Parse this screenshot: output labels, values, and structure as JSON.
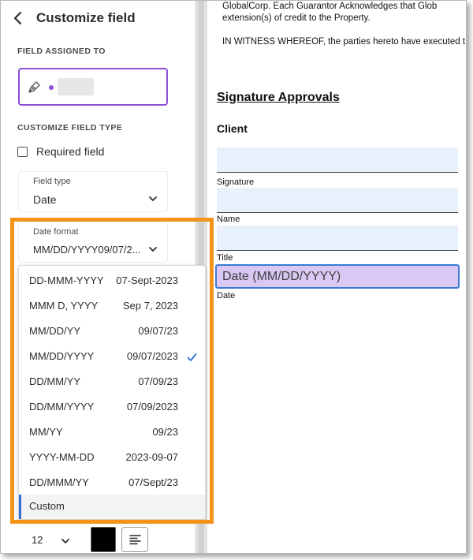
{
  "panel": {
    "title": "Customize field",
    "field_assigned_heading": "FIELD ASSIGNED TO",
    "customize_type_heading": "CUSTOMIZE FIELD TYPE",
    "required_label": "Required field",
    "required_checked": false,
    "field_type": {
      "caption": "Field type",
      "value": "Date"
    },
    "date_format": {
      "caption": "Date format",
      "value": "MM/DD/YYYY09/07/2..."
    },
    "font_size": "12",
    "text_color": "#000000",
    "partial_text_a": "",
    "partial_text_b": ""
  },
  "dropdown": {
    "options": [
      {
        "format": "DD-MMM-YYYY",
        "example": "07-Sept-2023"
      },
      {
        "format": "MMM D, YYYY",
        "example": "Sep 7, 2023"
      },
      {
        "format": "MM/DD/YY",
        "example": "09/07/23"
      },
      {
        "format": "MM/DD/YYYY",
        "example": "09/07/2023",
        "selected": true
      },
      {
        "format": "DD/MM/YY",
        "example": "07/09/23"
      },
      {
        "format": "DD/MM/YYYY",
        "example": "07/09/2023"
      },
      {
        "format": "MM/YY",
        "example": "09/23"
      },
      {
        "format": "YYYY-MM-DD",
        "example": "2023-09-07"
      },
      {
        "format": "DD/MMM/YY",
        "example": "07/Sept/23"
      }
    ],
    "custom_label": "Custom"
  },
  "document": {
    "intro_line1": "GlobalCorp. Each Guarantor Acknowledges that Glob",
    "intro_line2": "extension(s) of credit to the Property.",
    "witness_line": "IN WITNESS WHEREOF, the parties hereto have executed t",
    "heading": "Signature Approvals",
    "client_label": "Client",
    "fields": {
      "signature_caption": "Signature",
      "name_caption": "Name",
      "title_caption": "Title",
      "date_caption": "Date",
      "date_placeholder": "Date (MM/DD/YYYY)"
    }
  },
  "colors": {
    "accent_purple": "#8c4fd6",
    "highlight_orange": "#f39419",
    "field_blue": "#e8f0fb",
    "date_field_fill": "#d9c8f4",
    "focus_blue": "#3a7bd5",
    "check_blue": "#2f6fd6"
  },
  "icons": [
    "chevron-left-icon",
    "pen-icon",
    "chevron-down-icon",
    "checkmark-icon",
    "align-left-icon"
  ]
}
